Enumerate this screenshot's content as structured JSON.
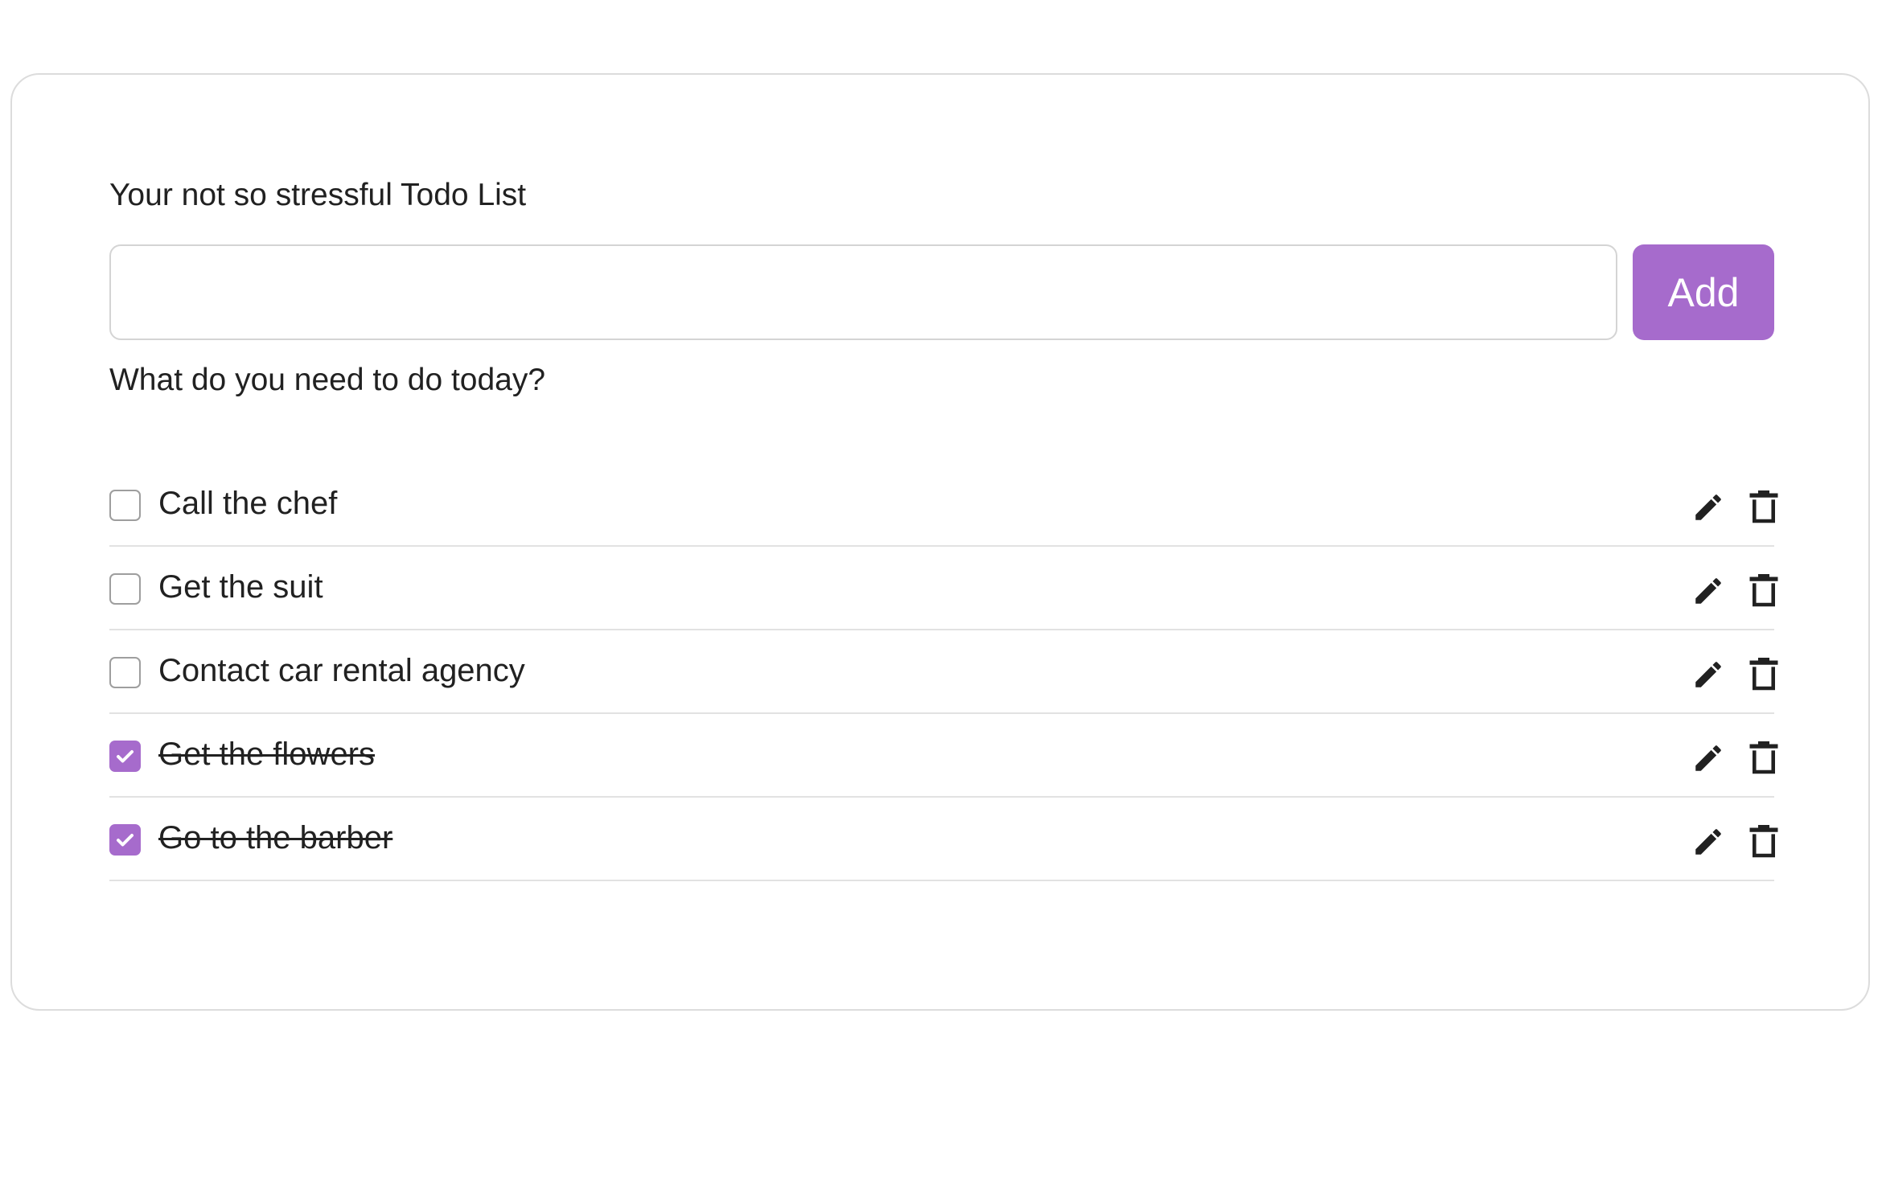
{
  "app": {
    "title": "Your not so stressful Todo List"
  },
  "form": {
    "input_value": "",
    "input_placeholder": "",
    "add_label": "Add",
    "hint": "What do you need to do today?"
  },
  "todos": [
    {
      "text": "Call the chef",
      "completed": false
    },
    {
      "text": "Get the suit",
      "completed": false
    },
    {
      "text": "Contact car rental agency",
      "completed": false
    },
    {
      "text": "Get the flowers",
      "completed": true
    },
    {
      "text": "Go to the barber",
      "completed": true
    }
  ],
  "icons": {
    "edit": "pencil-icon",
    "delete": "trash-icon",
    "check": "checkmark-icon"
  },
  "colors": {
    "accent": "#a66bcc",
    "text": "#212121",
    "border": "#dcdcdc"
  }
}
